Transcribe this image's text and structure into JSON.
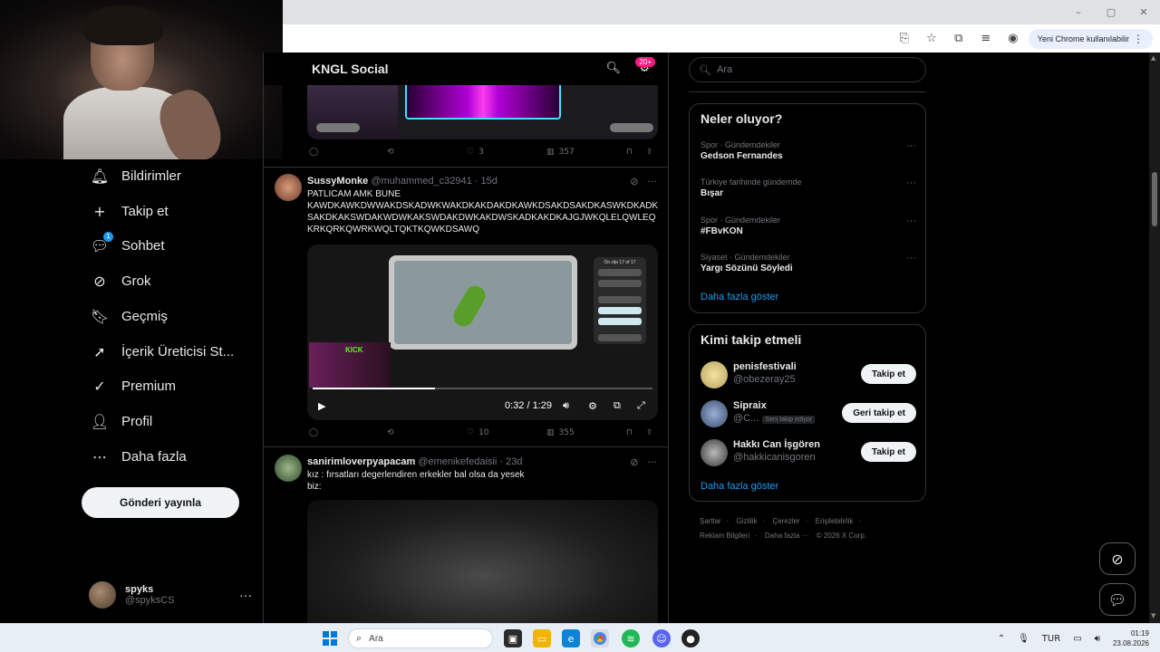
{
  "browser": {
    "update_label": "Yeni Chrome kullanılabilir",
    "window_controls": [
      "–",
      "▢",
      "✕"
    ]
  },
  "leftnav": {
    "items": [
      {
        "label": "Bildirimler",
        "icon": "bell-icon",
        "glyph": "🔔︎"
      },
      {
        "label": "Takip et",
        "icon": "follow-icon",
        "glyph": "+"
      },
      {
        "label": "Sohbet",
        "icon": "chat-icon",
        "glyph": "💬︎",
        "badge": "1"
      },
      {
        "label": "Grok",
        "icon": "grok-icon",
        "glyph": "⊘"
      },
      {
        "label": "Geçmiş",
        "icon": "bookmark-icon",
        "glyph": "🔖︎"
      },
      {
        "label": "İçerik Üreticisi St...",
        "icon": "rocket-icon",
        "glyph": "➚"
      },
      {
        "label": "Premium",
        "icon": "premium-icon",
        "glyph": "✓"
      },
      {
        "label": "Profil",
        "icon": "profile-icon",
        "glyph": "👤︎"
      },
      {
        "label": "Daha fazla",
        "icon": "more-icon",
        "glyph": "⋯"
      }
    ],
    "post_button": "Gönderi yayınla",
    "user": {
      "display_name": "spyks",
      "handle": "@spyksCS",
      "more": "···"
    }
  },
  "main": {
    "header_title": "KNGL Social",
    "header_badge": "20+",
    "post0_actions": {
      "replies": "",
      "reposts": "",
      "likes": "3",
      "views": "357"
    },
    "posts": [
      {
        "display_name": "SussyMonke",
        "handle": "@muhammed_c32941",
        "time": "· 15d",
        "text_line1": "PATLICAM AMK BUNE",
        "text_line2": "KAWDKAWKDWWAKDSKADWKWAKDKAKDAKDKAWKDSAKDSAKDKASWKDKADKSAKDKAKSWDAKWDWKAKSWDAKDWKAKDWSKADKAKDKAJGJWKQLELQWLEQKRKQRKQWRKWQLTQKTKQWKDSAWQ",
        "video": {
          "time": "0:32 / 1:29",
          "progress": 0.36,
          "panel_title": "On clip 17 of 17",
          "kick": "KICK"
        },
        "actions": {
          "likes": "10",
          "views": "355"
        }
      },
      {
        "display_name": "sanirimloverpyapacam",
        "handle": "@emenikefedaisii",
        "time": "· 23d",
        "text_line1": "kız : fırsatları degerlendiren erkekler bal olsa da yesek",
        "text_line2": "biz:"
      }
    ]
  },
  "right": {
    "search_placeholder": "Ara",
    "trends_title": "Neler oluyor?",
    "trends": [
      {
        "category": "Spor · Gündemdekiler",
        "name": "Gedson Fernandes"
      },
      {
        "category": "Türkiye tarihinde gündemde",
        "name": "Bışar"
      },
      {
        "category": "Spor · Gündemdekiler",
        "name": "#FBvKON"
      },
      {
        "category": "Siyaset · Gündemdekiler",
        "name": "Yargı Sözünü Söyledi"
      }
    ],
    "trends_more": "Daha fazla göster",
    "who_title": "Kimi takip etmeli",
    "who": [
      {
        "name": "penisfestivali",
        "handle": "@obezeray25",
        "button": "Takip et",
        "follows_you": ""
      },
      {
        "name": "Sipraix",
        "handle": "@C...",
        "button": "Geri takip et",
        "follows_you": "Seni takip ediyor"
      },
      {
        "name": "Hakkı Can İşgören",
        "handle": "@hakkicanisgoren",
        "button": "Takip et",
        "follows_you": ""
      }
    ],
    "who_more": "Daha fazla göster",
    "footer_line1": [
      "Şartlar",
      "Gizlilik",
      "Çerezler",
      "Erişilebilirlik"
    ],
    "footer_line2": [
      "Reklam Bilgileri",
      "Daha fazla ···",
      "© 2026 X Corp."
    ]
  },
  "taskbar": {
    "search_placeholder": "Ara",
    "lang": "TUR",
    "time": "01:19",
    "date": "23.08.2026"
  },
  "colors": {
    "accent": "#1d9bf0",
    "pink_badge": "#f91880",
    "border": "#2f3336"
  }
}
